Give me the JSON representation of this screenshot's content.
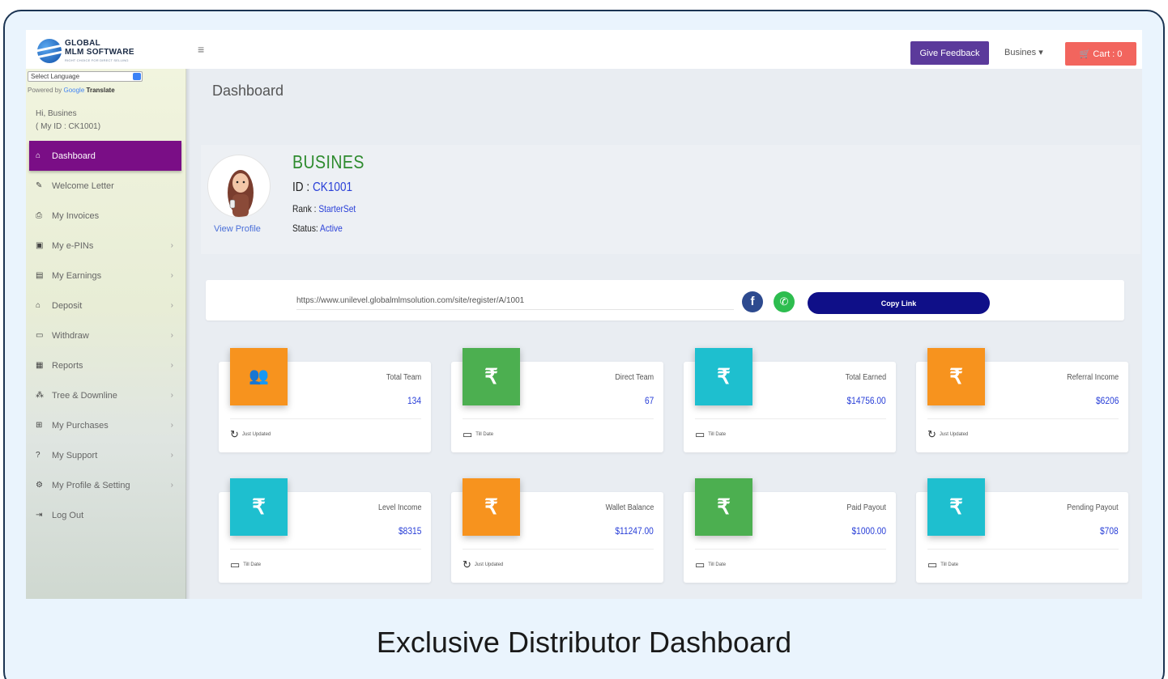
{
  "caption": "Exclusive Distributor Dashboard",
  "topbar": {
    "logo_line1": "GLOBAL",
    "logo_line2": "MLM SOFTWARE",
    "logo_tagline": "RIGHT CHOICE FOR DIRECT SELLING",
    "menu_icon": "hamburger-icon",
    "feedback_label": "Give Feedback",
    "user_label": "Busines ▾",
    "cart_label": "Cart : 0"
  },
  "sidebar": {
    "language_select": "Select Language",
    "powered_prefix": "Powered by",
    "powered_google": "Google",
    "powered_translate": "Translate",
    "greeting": "Hi, Busines",
    "my_id": "( My ID : CK1001)",
    "items": [
      {
        "label": "Dashboard",
        "icon": "home-icon",
        "glyph": "⌂",
        "has_children": false,
        "active": true
      },
      {
        "label": "Welcome Letter",
        "icon": "document-icon",
        "glyph": "✎",
        "has_children": false
      },
      {
        "label": "My Invoices",
        "icon": "printer-icon",
        "glyph": "⎙",
        "has_children": false
      },
      {
        "label": "My e-PINs",
        "icon": "pin-card-icon",
        "glyph": "▣",
        "has_children": true
      },
      {
        "label": "My Earnings",
        "icon": "money-icon",
        "glyph": "▤",
        "has_children": true
      },
      {
        "label": "Deposit",
        "icon": "bank-icon",
        "glyph": "⌂",
        "has_children": true
      },
      {
        "label": "Withdraw",
        "icon": "cash-icon",
        "glyph": "▭",
        "has_children": true
      },
      {
        "label": "Reports",
        "icon": "report-icon",
        "glyph": "▦",
        "has_children": true
      },
      {
        "label": "Tree & Downline",
        "icon": "tree-icon",
        "glyph": "⁂",
        "has_children": true
      },
      {
        "label": "My Purchases",
        "icon": "cart-icon",
        "glyph": "⊞",
        "has_children": true
      },
      {
        "label": "My Support",
        "icon": "question-icon",
        "glyph": "?",
        "has_children": true
      },
      {
        "label": "My Profile & Setting",
        "icon": "gear-icon",
        "glyph": "⚙",
        "has_children": true
      },
      {
        "label": "Log Out",
        "icon": "logout-icon",
        "glyph": "⇥",
        "has_children": false
      }
    ]
  },
  "main": {
    "page_title": "Dashboard",
    "profile": {
      "name": "BUSINES",
      "id_label": "ID : ",
      "id_value": "CK1001",
      "rank_label": "Rank : ",
      "rank_value": "StarterSet",
      "status_label": "Status: ",
      "status_value": "Active",
      "view_profile": "View Profile"
    },
    "referral": {
      "url": "https://www.unilevel.globalmlmsolution.com/site/register/A/1001",
      "facebook_glyph": "f",
      "whatsapp_glyph": "✆",
      "copy_label": "Copy Link"
    },
    "stats": [
      {
        "label": "Total Team",
        "value": "134",
        "footer": "Just Updated",
        "foot_icon": "refresh-icon",
        "foot_glyph": "↻",
        "icon": "team-icon",
        "glyph": "👥",
        "color": "#f7931e"
      },
      {
        "label": "Direct Team",
        "value": "67",
        "footer": "Till Date",
        "foot_icon": "calendar-icon",
        "foot_glyph": "▭",
        "icon": "rupee-icon",
        "glyph": "₹",
        "color": "#4caf50"
      },
      {
        "label": "Total Earned",
        "value": "$14756.00",
        "footer": "Till Date",
        "foot_icon": "calendar-icon",
        "foot_glyph": "▭",
        "icon": "rupee-icon",
        "glyph": "₹",
        "color": "#1ebfcf"
      },
      {
        "label": "Referral Income",
        "value": "$6206",
        "footer": "Just Updated",
        "foot_icon": "refresh-icon",
        "foot_glyph": "↻",
        "icon": "rupee-icon",
        "glyph": "₹",
        "color": "#f7931e"
      },
      {
        "label": "Level Income",
        "value": "$8315",
        "footer": "Till Date",
        "foot_icon": "calendar-icon",
        "foot_glyph": "▭",
        "icon": "rupee-icon",
        "glyph": "₹",
        "color": "#1ebfcf"
      },
      {
        "label": "Wallet Balance",
        "value": "$11247.00",
        "footer": "Just Updated",
        "foot_icon": "refresh-icon",
        "foot_glyph": "↻",
        "icon": "rupee-icon",
        "glyph": "₹",
        "color": "#f7931e"
      },
      {
        "label": "Paid Payout",
        "value": "$1000.00",
        "footer": "Till Date",
        "foot_icon": "calendar-icon",
        "foot_glyph": "▭",
        "icon": "rupee-icon",
        "glyph": "₹",
        "color": "#4caf50"
      },
      {
        "label": "Pending Payout",
        "value": "$708",
        "footer": "Till Date",
        "foot_icon": "calendar-icon",
        "foot_glyph": "▭",
        "icon": "rupee-icon",
        "glyph": "₹",
        "color": "#1ebfcf"
      }
    ]
  }
}
